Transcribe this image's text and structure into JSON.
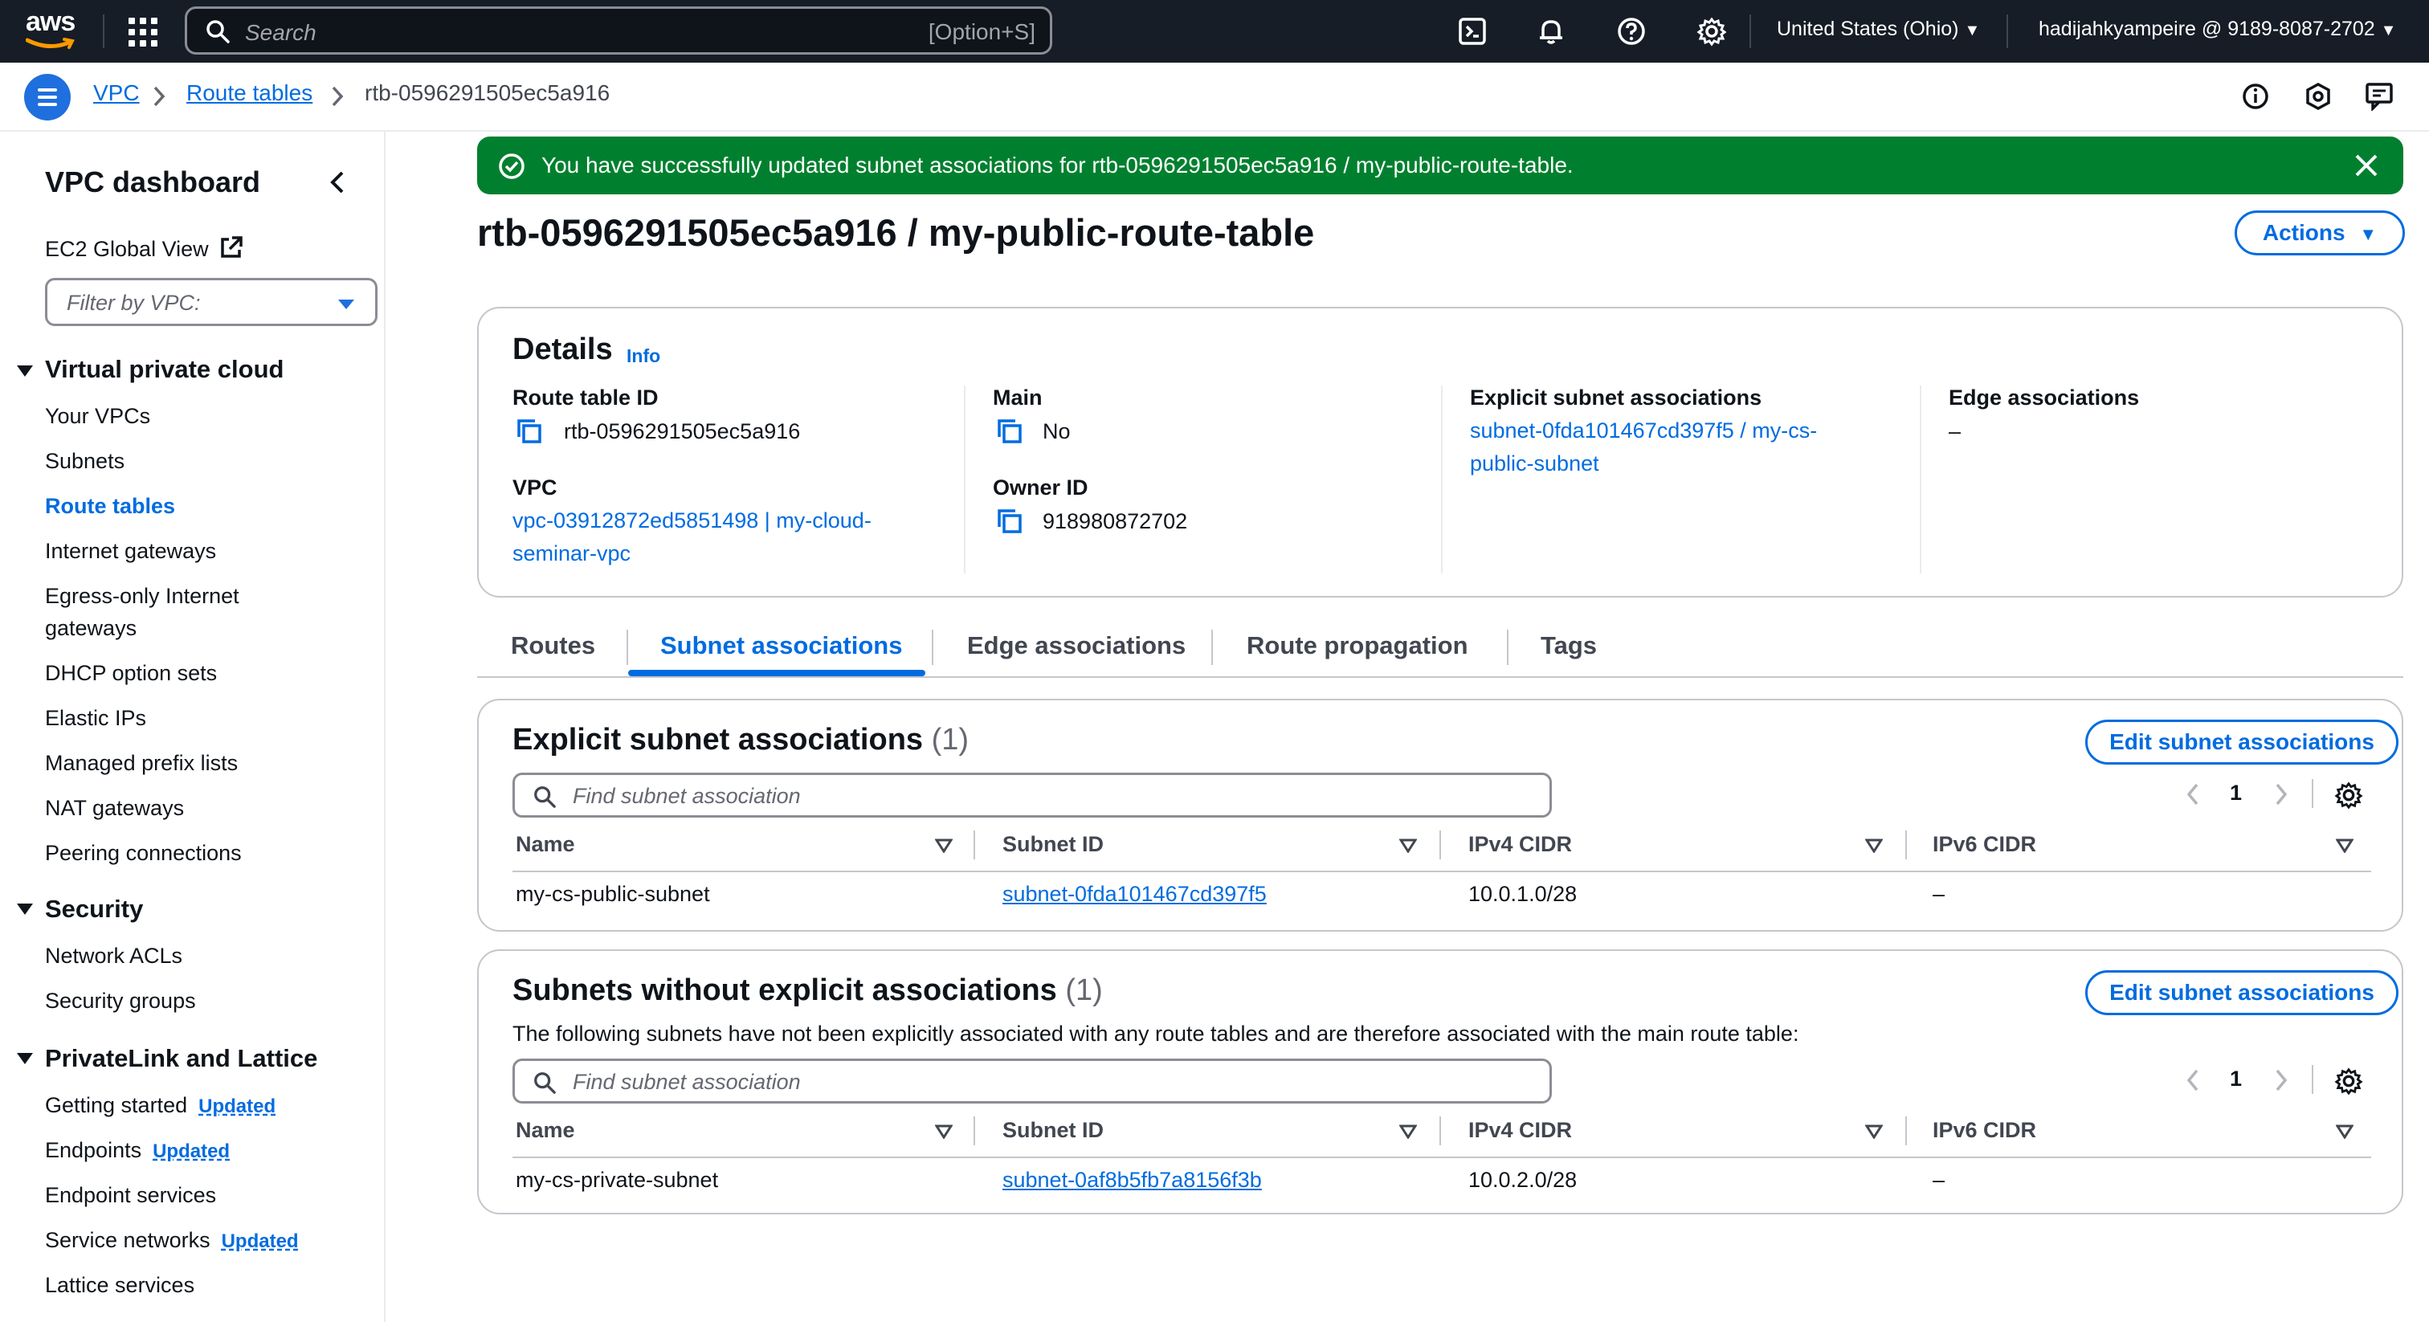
{
  "topbar": {
    "logo_text": "aws",
    "search_placeholder": "Search",
    "search_shortcut": "[Option+S]",
    "region": "United States (Ohio)",
    "account": "hadijahkyampeire @ 9189-8087-2702"
  },
  "breadcrumb": {
    "items": [
      "VPC",
      "Route tables",
      "rtb-0596291505ec5a916"
    ]
  },
  "sidebar": {
    "title": "VPC dashboard",
    "ec2_global_view": "EC2 Global View",
    "filter_placeholder": "Filter by VPC:",
    "sections": [
      {
        "title": "Virtual private cloud",
        "items": [
          "Your VPCs",
          "Subnets",
          "Route tables",
          "Internet gateways",
          "Egress-only Internet",
          "gateways",
          "DHCP option sets",
          "Elastic IPs",
          "Managed prefix lists",
          "NAT gateways",
          "Peering connections"
        ]
      },
      {
        "title": "Security",
        "items": [
          "Network ACLs",
          "Security groups"
        ]
      },
      {
        "title": "PrivateLink and Lattice",
        "items": [
          "Getting started",
          "Endpoints",
          "Endpoint services",
          "Service networks",
          "Lattice services"
        ]
      }
    ],
    "updated_badge": "Updated",
    "active_item": "Route tables"
  },
  "flash": {
    "message": "You have successfully updated subnet associations for rtb-0596291505ec5a916 / my-public-route-table."
  },
  "page": {
    "title": "rtb-0596291505ec5a916 / my-public-route-table",
    "actions_label": "Actions"
  },
  "details": {
    "heading": "Details",
    "info": "Info",
    "route_table_id_label": "Route table ID",
    "route_table_id": "rtb-0596291505ec5a916",
    "vpc_label": "VPC",
    "vpc_line1": "vpc-03912872ed5851498 | my-cloud-",
    "vpc_line2": "seminar-vpc",
    "main_label": "Main",
    "main_value": "No",
    "owner_label": "Owner ID",
    "owner_value": "918980872702",
    "explicit_label": "Explicit subnet associations",
    "explicit_line1": "subnet-0fda101467cd397f5 / my-cs-",
    "explicit_line2": "public-subnet",
    "edge_label": "Edge associations",
    "edge_value": "–"
  },
  "tabs": [
    "Routes",
    "Subnet associations",
    "Edge associations",
    "Route propagation",
    "Tags"
  ],
  "explicit_table": {
    "title": "Explicit subnet associations",
    "count": "(1)",
    "edit_label": "Edit subnet associations",
    "find_placeholder": "Find subnet association",
    "page": "1",
    "columns": [
      "Name",
      "Subnet ID",
      "IPv4 CIDR",
      "IPv6 CIDR"
    ],
    "rows": [
      {
        "name": "my-cs-public-subnet",
        "subnet_id": "subnet-0fda101467cd397f5",
        "ipv4": "10.0.1.0/28",
        "ipv6": "–"
      }
    ]
  },
  "nonexplicit_table": {
    "title": "Subnets without explicit associations",
    "count": "(1)",
    "description": "The following subnets have not been explicitly associated with any route tables and are therefore associated with the main route table:",
    "edit_label": "Edit subnet associations",
    "find_placeholder": "Find subnet association",
    "page": "1",
    "columns": [
      "Name",
      "Subnet ID",
      "IPv4 CIDR",
      "IPv6 CIDR"
    ],
    "rows": [
      {
        "name": "my-cs-private-subnet",
        "subnet_id": "subnet-0af8b5fb7a8156f3b",
        "ipv4": "10.0.2.0/28",
        "ipv6": "–"
      }
    ]
  },
  "colors": {
    "nav_bg": "#161d26",
    "accent": "#006ce0",
    "success": "#00802f",
    "border": "#c6c6cd"
  },
  "icons": [
    "aws-logo",
    "apps-grid-icon",
    "search-icon",
    "cloudshell-icon",
    "bell-icon",
    "help-icon",
    "gear-icon",
    "menu-icon",
    "chevron-right-icon",
    "info-circle-icon",
    "settings-hex-icon",
    "feedback-icon",
    "collapse-left-icon",
    "external-link-icon",
    "caret-down-icon",
    "check-circle-icon",
    "close-icon",
    "copy-icon",
    "sort-icon",
    "chevron-left-icon"
  ]
}
